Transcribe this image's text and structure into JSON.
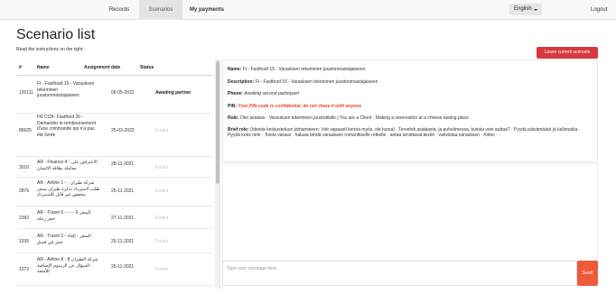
{
  "nav": {
    "tabs": [
      {
        "label": "Records"
      },
      {
        "label": "Scenarios"
      },
      {
        "label": "My payments"
      }
    ],
    "language": "English",
    "logout": "Logout"
  },
  "page": {
    "title": "Scenario list",
    "instructions": "Read the instructions on the right:"
  },
  "table": {
    "headers": [
      "#",
      "Name",
      "Assignment date",
      "Status"
    ],
    "rows": [
      {
        "num": "120111",
        "name": "FI - Fastfood 15 - Varauksen tekeminen juustonmaistajaiseen",
        "date": "06-05-2022",
        "status": "Awaiting partner"
      },
      {
        "num": "85625",
        "name": "FR CCB- Fastfood 20 - Demander le remboursement d'une commande qui n'a pas été livrée",
        "date": "25-03-2022",
        "status": "Ended"
      },
      {
        "num": "3010",
        "name": "AR - Finance 4 - الاعتراض على معاملة بطاقة الائتمان",
        "date": "28-11-2021",
        "status": "Ended"
      },
      {
        "num": "2876",
        "name": "AR - Airline 1 - شركة طيران - طلب لاسترداد تذكرة طيران بسعر مخفض غير قابل للاسترداد",
        "date": "25-11-2021",
        "status": "Ended"
      },
      {
        "num": "2392",
        "name": "AR - Travel 6 - - - السفر 6 - حجز رحلة",
        "date": "27-11-2021",
        "status": "Ended"
      },
      {
        "num": "1205",
        "name": "AR - Travel 2 - السفر - إلغاء حجز في فندق",
        "date": "25-11-2021",
        "status": "Ended"
      },
      {
        "num": "1272",
        "name": "AR - Airline 8 - شركة الطيران 8 - السؤال عن الرسوم الإضافية للأمتعة",
        "date": "25-11-2021",
        "status": "Ended"
      }
    ]
  },
  "info": {
    "leave_button": "Leave current scenario",
    "name_label": "Name:",
    "name_value": " FI - Fastfood 15 - Varauksen tekeminen juustonmaistajaiseen",
    "description_label": "Description:",
    "description_value": " FI - Fastfood 15 - Varauksen tekeminen juustonmaistajaiseen",
    "phone_label": "Phone:",
    "phone_value": " Awaiting second participant",
    "pin_label": "PIN:",
    "pin_value": " Your PIN-code is confidential, do not share it with anyone",
    "role_label": "Role:",
    "role_value": " Olet asiakas · Varauksen tekeminen juustotilalle | You are a Client · Making a reservation at a cheese tasting place",
    "brief_label": "Brief role:",
    "brief_value": " (Ideoita keskusteluun johtamiseen: Voit vapaasti kertoa myös, ole luova) · Tervehdi asiakasta, ja puhelimessa, kuinka voin auttaa? · Pyydä päivämäärä ja kellonaika · Pyydä koko nimi · Toista varaus · haluaa tehdä varauksen romanttiselle retkelle · antaa tarvittavat tiedot · vahvistaa varauksen · Kiitos · -"
  },
  "chat": {
    "placeholder": "Type your message here..",
    "send": "Send"
  }
}
